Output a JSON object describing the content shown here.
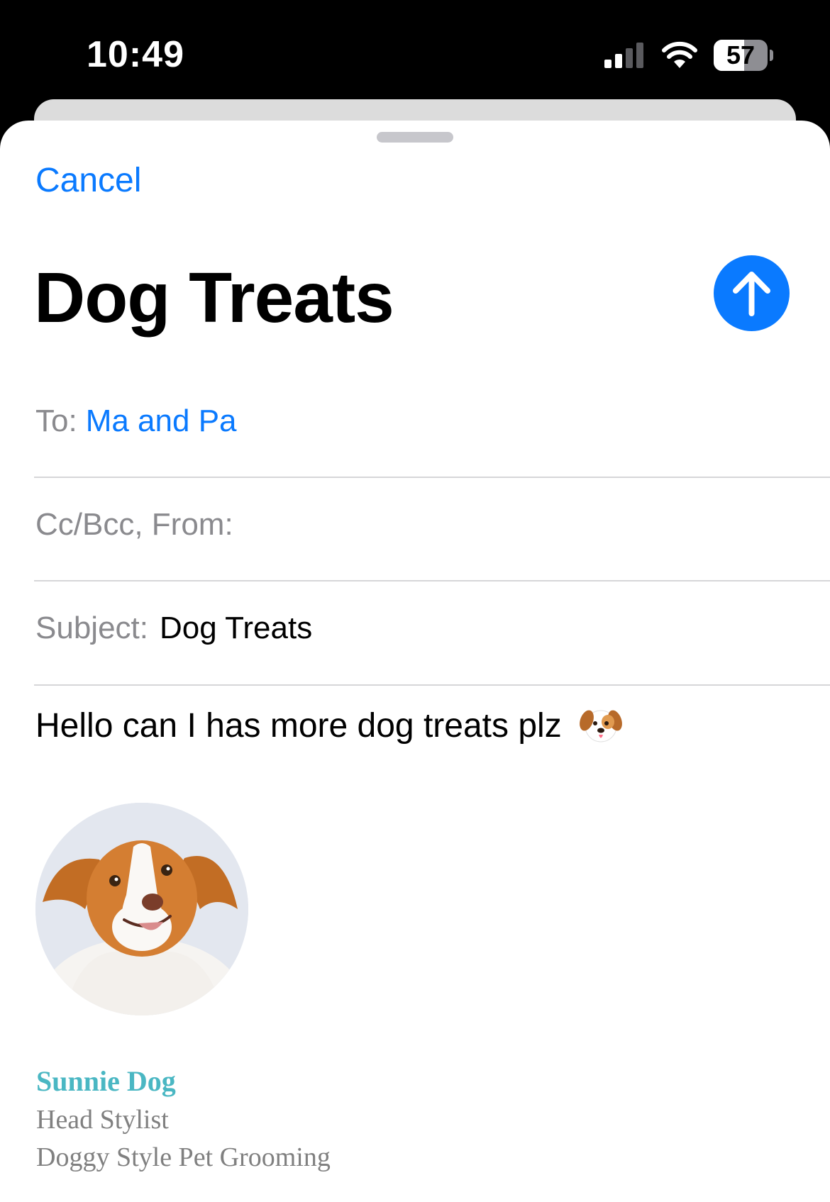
{
  "status_bar": {
    "time": "10:49",
    "battery_level": "57",
    "battery_fraction": 0.57,
    "icons": [
      "cellular-signal-icon",
      "wifi-icon",
      "battery-icon"
    ]
  },
  "compose": {
    "cancel_label": "Cancel",
    "title": "Dog Treats",
    "send_icon": "arrow-up-icon",
    "to_label": "To:",
    "to_value": "Ma and Pa",
    "cc_label": "Cc/Bcc, From:",
    "subject_label": "Subject:",
    "subject_value": "Dog Treats",
    "body": "Hello can I has more dog treats plz",
    "body_emoji_icon": "dog-face-emoji-icon"
  },
  "signature": {
    "name": "Sunnie Dog",
    "title": "Head Stylist",
    "company": "Doggy Style Pet Grooming"
  },
  "colors": {
    "accent": "#0a7aff",
    "signature_name": "#4ab7c3",
    "label_gray": "#8a8a8e",
    "background": "#ffffff",
    "status_bar": "#000000"
  }
}
